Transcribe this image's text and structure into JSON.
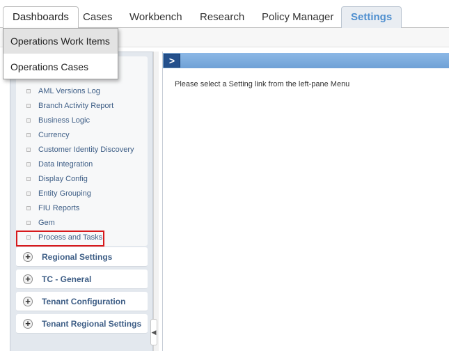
{
  "tabs": [
    {
      "label": "Dashboards"
    },
    {
      "label": "Cases"
    },
    {
      "label": "Workbench"
    },
    {
      "label": "Research"
    },
    {
      "label": "Policy Manager"
    },
    {
      "label": "Settings"
    }
  ],
  "dashboards_menu": {
    "items": [
      {
        "label": "Operations Work Items"
      },
      {
        "label": "Operations Cases"
      }
    ]
  },
  "sidebar": {
    "items": [
      {
        "label": "AML Versions Log"
      },
      {
        "label": "Branch Activity Report"
      },
      {
        "label": "Business Logic"
      },
      {
        "label": "Currency"
      },
      {
        "label": "Customer Identity Discovery"
      },
      {
        "label": "Data Integration"
      },
      {
        "label": "Display Config"
      },
      {
        "label": "Entity Grouping"
      },
      {
        "label": "FIU Reports"
      },
      {
        "label": "Gem"
      },
      {
        "label": "Process and Tasks"
      }
    ],
    "sections": [
      {
        "label": "Regional Settings"
      },
      {
        "label": "TC - General"
      },
      {
        "label": "Tenant Configuration"
      },
      {
        "label": "Tenant Regional Settings"
      }
    ]
  },
  "content": {
    "message": "Please select a Setting link from the left-pane Menu"
  },
  "colors": {
    "accent": "#4f8fcf",
    "selection_highlight": "#d7191c",
    "header_bar": "#6fa1d6"
  }
}
